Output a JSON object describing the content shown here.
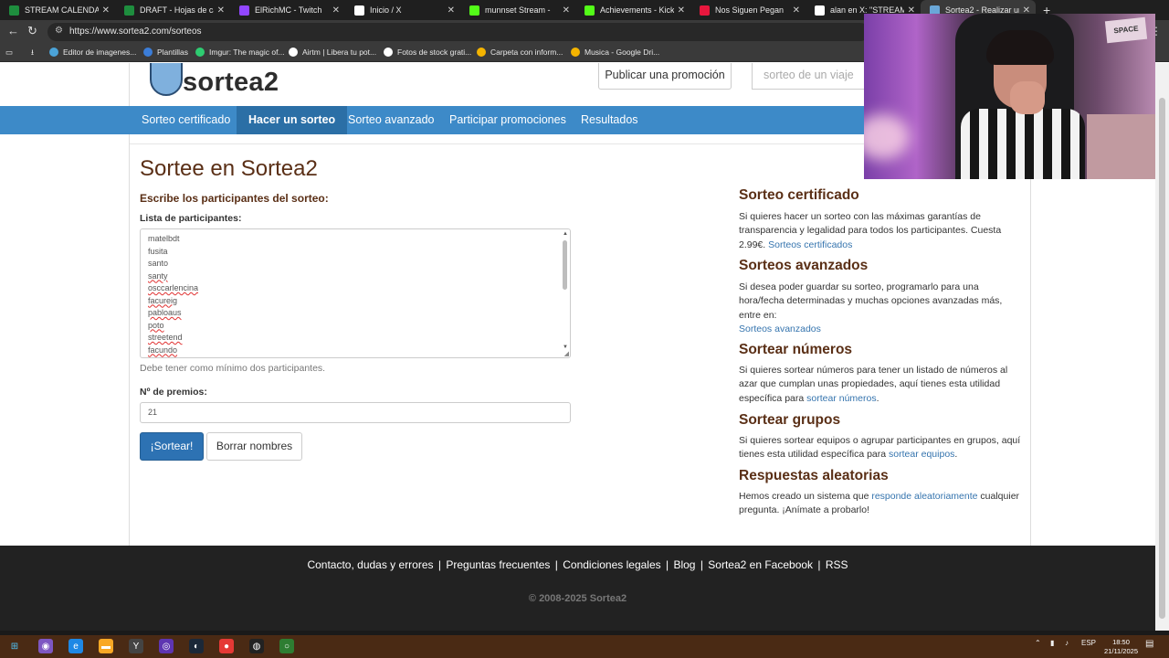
{
  "browser": {
    "tabs": [
      {
        "label": "STREAM CALENDAR - H",
        "color": "#1e8e3e",
        "active": false
      },
      {
        "label": "DRAFT - Hojas de cálcul",
        "color": "#1e8e3e",
        "active": false
      },
      {
        "label": "ElRichMC - Twitch",
        "color": "#9146ff",
        "active": false
      },
      {
        "label": "Inicio / X",
        "color": "#ffffff",
        "active": false
      },
      {
        "label": "munnset Stream -",
        "color": "#53fc18",
        "active": false
      },
      {
        "label": "Achievements - Kick Da",
        "color": "#53fc18",
        "active": false
      },
      {
        "label": "Nos Siguen Pegan",
        "color": "#e8173d",
        "active": false
      },
      {
        "label": "alan en X: \"STREAMER I",
        "color": "#ffffff",
        "active": false
      },
      {
        "label": "Sortea2 - Realizar un so",
        "color": "#6aa7d8",
        "active": true
      }
    ],
    "tab_close": "✕",
    "new_tab": "+",
    "url": "https://www.sortea2.com/sorteos",
    "bookmarks": [
      {
        "label": "Editor de imagenes...",
        "color": "#4ba3d8"
      },
      {
        "label": "Plantillas",
        "color": "#3b7dd8"
      },
      {
        "label": "Imgur: The magic of...",
        "color": "#2ecc71"
      },
      {
        "label": "Airtm | Libera tu pot...",
        "color": "#ffffff"
      },
      {
        "label": "Fotos de stock grati...",
        "color": "#ffffff"
      },
      {
        "label": "Carpeta con inform...",
        "color": "#f4b400"
      },
      {
        "label": "Musica - Google Dri...",
        "color": "#f4b400"
      }
    ]
  },
  "site": {
    "logo_text": "sortea2",
    "publish_button": "Publicar una promoción",
    "search_placeholder": "sorteo de un viaje",
    "nav": [
      {
        "label": "Sorteo certificado",
        "active": false
      },
      {
        "label": "Hacer un sorteo",
        "active": true
      },
      {
        "label": "Sorteo avanzado",
        "active": false
      },
      {
        "label": "Participar promociones",
        "active": false
      },
      {
        "label": "Resultados",
        "active": false
      }
    ]
  },
  "form": {
    "title": "Sortee en Sortea2",
    "subtitle": "Escribe los participantes del sorteo:",
    "participants_label": "Lista de participantes:",
    "participants": [
      "matelbdt",
      "fusita",
      "santo",
      "santy",
      "osccarlencina",
      "facureig",
      "pabloaus",
      "poto",
      "streetend",
      "facundo"
    ],
    "help_text": "Debe tener como mínimo dos participantes.",
    "prizes_label": "Nº de premios:",
    "prizes_value": "21",
    "draw_button": "¡Sortear!",
    "clear_button": "Borrar nombres"
  },
  "sidebar": {
    "certified": {
      "title": "Sorteo certificado",
      "text": "Si quieres hacer un sorteo con las máximas garantías de transparencia y legalidad para todos los participantes. Cuesta 2.99€.",
      "link": "Sorteos certificados"
    },
    "advanced": {
      "title": "Sorteos avanzados",
      "text": "Si desea poder guardar su sorteo, programarlo para una hora/fecha determinadas y muchas opciones avanzadas más, entre en:",
      "link": "Sorteos avanzados"
    },
    "numbers": {
      "title": "Sortear números",
      "text": "Si quieres sortear números para tener un listado de números al azar que cumplan unas propiedades, aquí tienes esta utilidad específica para",
      "link": "sortear números",
      "suffix": "."
    },
    "groups": {
      "title": "Sortear grupos",
      "text": "Si quieres sortear equipos o agrupar participantes en grupos, aquí tienes esta utilidad específica para",
      "link": "sortear equipos",
      "suffix": "."
    },
    "random": {
      "title": "Respuestas aleatorias",
      "text": "Hemos creado un sistema que",
      "link": "responde aleatoriamente",
      "suffix": "cualquier pregunta. ¡Anímate a probarlo!"
    }
  },
  "footer": {
    "links": [
      "Contacto, dudas y errores",
      "Preguntas frecuentes",
      "Condiciones legales",
      "Blog",
      "Sortea2 en Facebook",
      "RSS"
    ],
    "separator": "|",
    "copyright": "© 2008-2025 Sortea2"
  },
  "webcam": {
    "sign_text": "SPACE"
  },
  "taskbar": {
    "lang": "ESP",
    "time": "18:50",
    "date": "21/11/2025"
  }
}
